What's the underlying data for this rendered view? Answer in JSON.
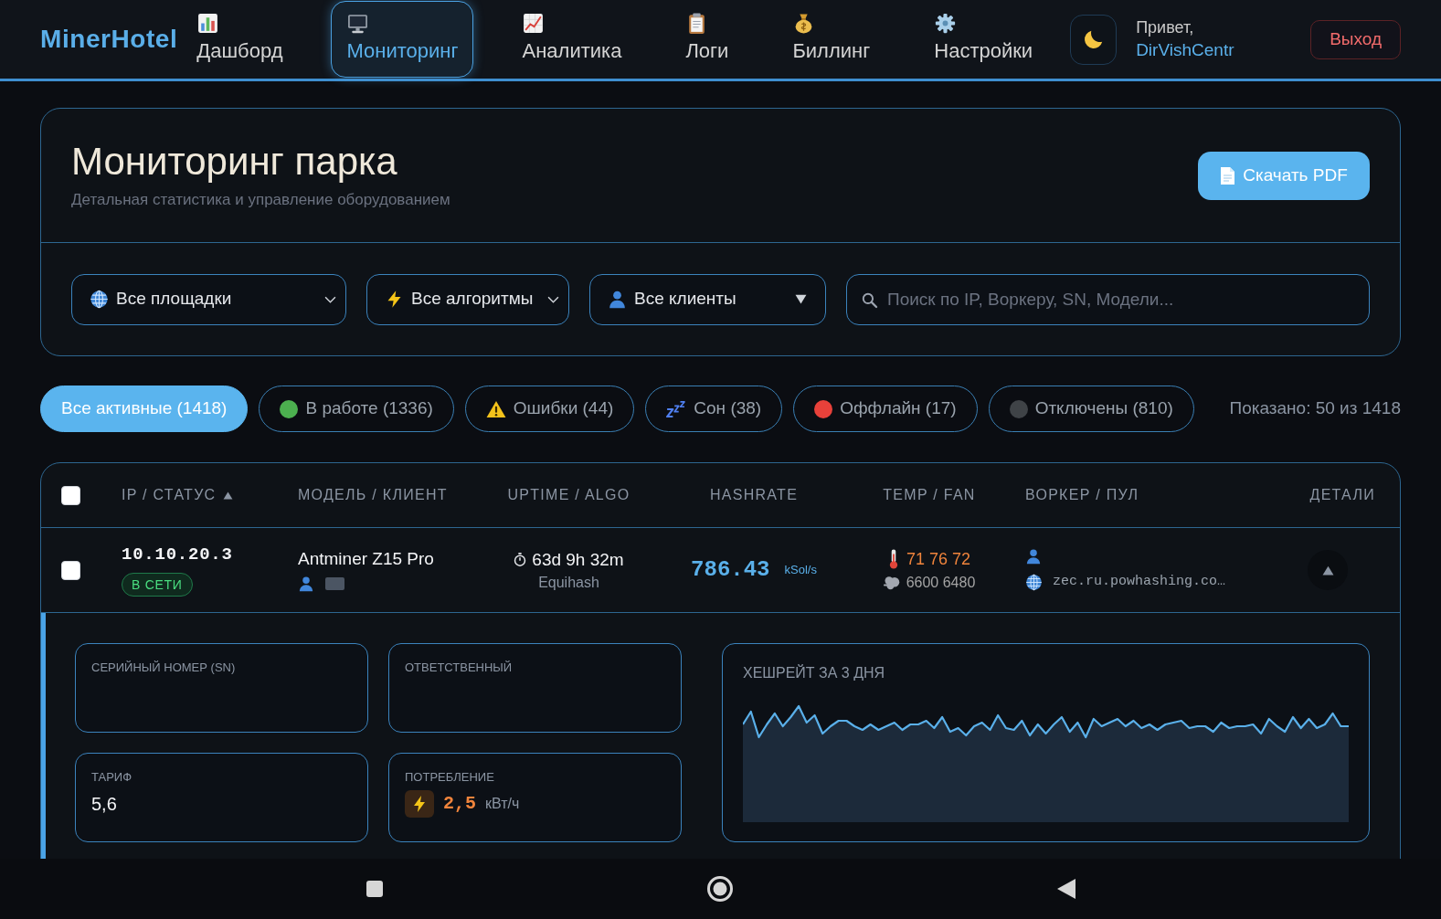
{
  "header": {
    "logo": "MinerHotel",
    "nav": [
      {
        "label": "Дашборд",
        "selected": false
      },
      {
        "label": "Мониторинг",
        "selected": true
      },
      {
        "label": "Аналитика",
        "selected": false
      },
      {
        "label": "Логи",
        "selected": false
      },
      {
        "label": "Биллинг",
        "selected": false
      },
      {
        "label": "Настройки",
        "selected": false
      }
    ],
    "greeting": "Привет,",
    "username": "DirVishCentr",
    "logout": "Выход"
  },
  "page": {
    "title": "Мониторинг парка",
    "subtitle": "Детальная статистика и управление оборудованием",
    "download_button": "Скачать PDF"
  },
  "filters": [
    {
      "kind": "select",
      "value": "Все площадки"
    },
    {
      "kind": "select",
      "value": "Все алгоритмы"
    },
    {
      "kind": "dropdown",
      "value": "Все клиенты"
    },
    {
      "kind": "search",
      "placeholder": "Поиск по IP, Воркеру, SN, Модели..."
    }
  ],
  "status_chips": [
    {
      "label": "Все активные (1418)",
      "kind": "plain",
      "selected": true
    },
    {
      "label": "В работе (1336)",
      "kind": "dot",
      "color": "#4cb04f",
      "selected": false
    },
    {
      "label": "Ошибки (44)",
      "kind": "warning",
      "selected": false
    },
    {
      "label": "Сон (38)",
      "kind": "sleep",
      "selected": false
    },
    {
      "label": "Оффлайн (17)",
      "kind": "dot",
      "color": "#e8413a",
      "selected": false
    },
    {
      "label": "Отключены (810)",
      "kind": "dot",
      "color": "#3f4347",
      "selected": false
    }
  ],
  "shown_count": "Показано: 50 из 1418",
  "table": {
    "select_all": {
      "checked": false
    },
    "columns": [
      {
        "label": "IP / СТАТУС",
        "sorted": true
      },
      {
        "label": "МОДЕЛЬ / КЛИЕНТ",
        "sorted": false
      },
      {
        "label": "UPTIME / ALGO",
        "sorted": false
      },
      {
        "label": "HASHRATE",
        "sorted": false
      },
      {
        "label": "TEMP / FAN",
        "sorted": false
      },
      {
        "label": "ВОРКЕР / ПУЛ",
        "sorted": false
      },
      {
        "label": "ДЕТАЛИ",
        "sorted": false
      }
    ],
    "rows": [
      {
        "checked": false,
        "expanded": true,
        "ip": "10.10.20.3",
        "status": {
          "label": "В СЕТИ",
          "kind": "online"
        },
        "model": "Antminer Z15 Pro",
        "uptime": "63d 9h 32m",
        "algo": "Equihash",
        "hashrate": "786.43",
        "hashrate_unit": "kSol/s",
        "temps": "71 76 72",
        "fans": "6600 6480",
        "pool": "zec.ru.powhashing.co…",
        "details": {
          "fields": [
            {
              "label": "СЕРИЙНЫЙ НОМЕР (SN)",
              "kind": "text"
            },
            {
              "label": "ОТВЕТСТВЕННЫЙ",
              "kind": "text"
            },
            {
              "label": "ТАРИФ",
              "kind": "text",
              "value": "5,6"
            },
            {
              "label": "ПОТРЕБЛЕНИЕ",
              "kind": "power",
              "value": "2,5",
              "unit": "кВт/ч"
            }
          ],
          "chart_title": "ХЕШРЕЙТ ЗА 3 ДНЯ"
        }
      }
    ]
  }
}
